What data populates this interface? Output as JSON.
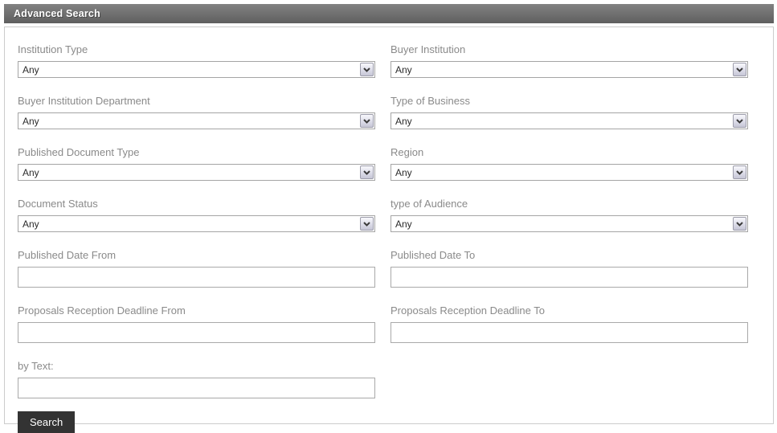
{
  "header": {
    "title": "Advanced Search"
  },
  "form": {
    "selects": [
      {
        "label": "Institution Type",
        "value": "Any"
      },
      {
        "label": "Buyer Institution",
        "value": "Any"
      },
      {
        "label": "Buyer Institution Department",
        "value": "Any"
      },
      {
        "label": "Type of Business",
        "value": "Any"
      },
      {
        "label": "Published Document Type",
        "value": "Any"
      },
      {
        "label": "Region",
        "value": "Any"
      },
      {
        "label": "Document Status",
        "value": "Any"
      },
      {
        "label": "type of Audience",
        "value": "Any"
      }
    ],
    "text_fields": [
      {
        "label": "Published Date From",
        "value": ""
      },
      {
        "label": "Published Date To",
        "value": ""
      },
      {
        "label": "Proposals Reception Deadline From",
        "value": ""
      },
      {
        "label": "Proposals Reception Deadline To",
        "value": ""
      },
      {
        "label": "by Text:",
        "value": ""
      }
    ],
    "search_button_label": "Search"
  },
  "colors": {
    "header_bg": "#6f6f6f",
    "panel_border": "#cccccc",
    "label_text": "#8a8a8a",
    "button_bg": "#333333"
  }
}
